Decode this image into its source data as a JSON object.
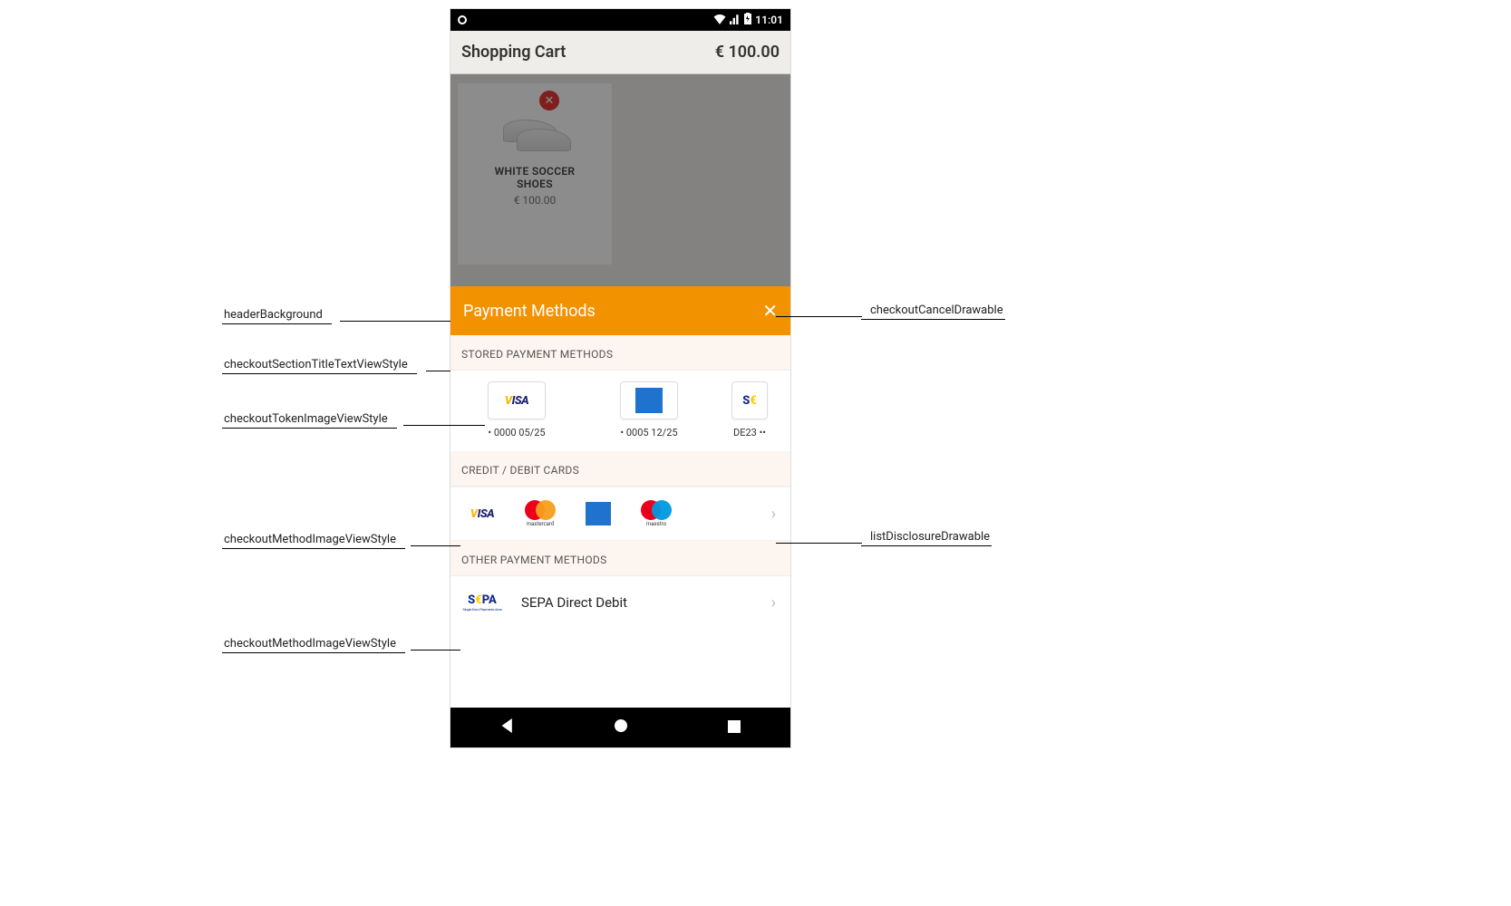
{
  "status": {
    "time": "11:01"
  },
  "cart": {
    "title": "Shopping Cart",
    "total": "€ 100.00",
    "item": {
      "name_l1": "WHITE SOCCER",
      "name_l2": "SHOES",
      "price": "€ 100.00"
    }
  },
  "sheet": {
    "title": "Payment Methods",
    "sections": {
      "stored_title": "STORED PAYMENT METHODS",
      "stored": [
        {
          "brand": "VISA",
          "sub": "• 0000 05/25"
        },
        {
          "brand": "AMEX",
          "sub": "• 0005 12/25"
        },
        {
          "brand": "SEPA",
          "sub": "DE23 ••"
        }
      ],
      "cards_title": "CREDIT / DEBIT CARDS",
      "other_title": "OTHER PAYMENT METHODS",
      "other_item": "SEPA Direct Debit"
    }
  },
  "annotations": {
    "left": [
      "headerBackground",
      "checkoutSectionTitleTextViewStyle",
      "checkoutTokenImageViewStyle",
      "checkoutMethodImageViewStyle",
      "checkoutMethodImageViewStyle"
    ],
    "right": [
      "checkoutCancelDrawable",
      "listDisclosureDrawable"
    ]
  }
}
